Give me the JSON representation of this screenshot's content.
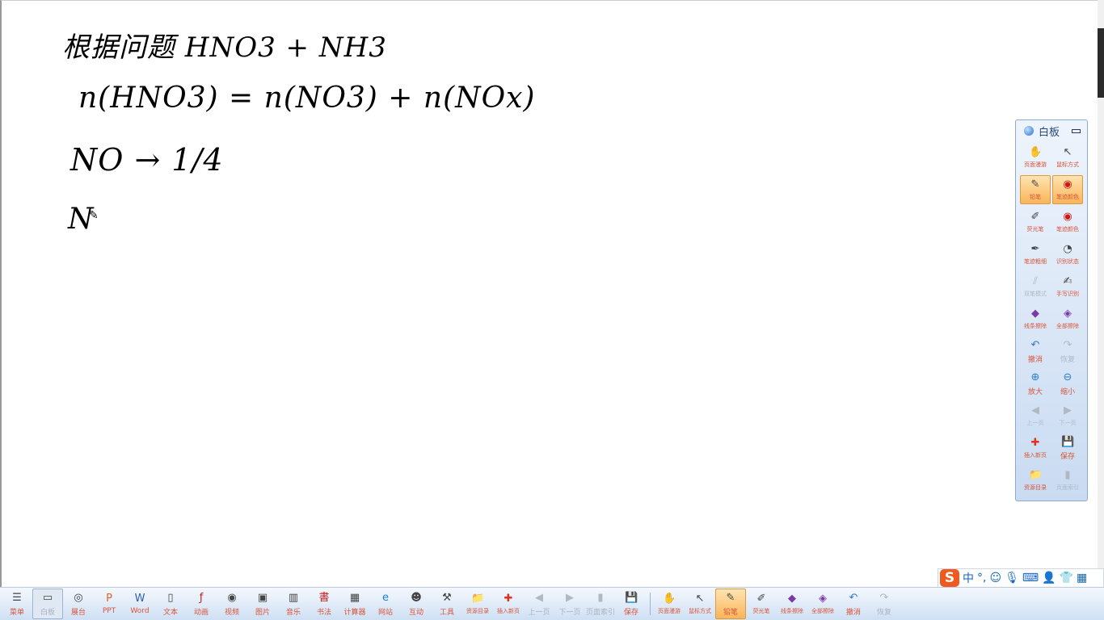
{
  "whiteboard": {
    "lines": [
      "根据问题 HNO3 + NH3",
      "n(HNO3) = n(NO3) + n(NOx)",
      "NO → 1/4",
      "N"
    ]
  },
  "panel": {
    "title": "白板",
    "tools": [
      {
        "label": "页面漫游",
        "icon": "hand-icon",
        "state": "normal"
      },
      {
        "label": "鼠标方式",
        "icon": "cursor-icon",
        "state": "normal"
      },
      {
        "label": "铅笔",
        "icon": "pencil-icon",
        "state": "active"
      },
      {
        "label": "笔迹颜色",
        "icon": "color-icon",
        "state": "active"
      },
      {
        "label": "荧光笔",
        "icon": "highlighter-icon",
        "state": "normal"
      },
      {
        "label": "笔迹颜色",
        "icon": "color-icon",
        "state": "normal"
      },
      {
        "label": "笔迹粗细",
        "icon": "pen-width-icon",
        "state": "normal"
      },
      {
        "label": "识别状态",
        "icon": "recognize-icon",
        "state": "normal"
      },
      {
        "label": "双笔模式",
        "icon": "dual-pen-icon",
        "state": "disabled"
      },
      {
        "label": "手写识别",
        "icon": "handwriting-icon",
        "state": "normal"
      },
      {
        "label": "线条擦除",
        "icon": "eraser-icon",
        "state": "normal"
      },
      {
        "label": "全部擦除",
        "icon": "clear-all-icon",
        "state": "normal"
      },
      {
        "label": "撤消",
        "icon": "undo-icon",
        "state": "big"
      },
      {
        "label": "恢复",
        "icon": "redo-icon",
        "state": "disabled-big"
      },
      {
        "label": "放大",
        "icon": "zoom-in-icon",
        "state": "big"
      },
      {
        "label": "缩小",
        "icon": "zoom-out-icon",
        "state": "big"
      },
      {
        "label": "上一页",
        "icon": "prev-page-icon",
        "state": "disabled"
      },
      {
        "label": "下一页",
        "icon": "next-page-icon",
        "state": "disabled"
      },
      {
        "label": "插入新页",
        "icon": "insert-page-icon",
        "state": "normal"
      },
      {
        "label": "保存",
        "icon": "save-icon",
        "state": "big"
      },
      {
        "label": "资源目录",
        "icon": "folder-icon",
        "state": "normal"
      },
      {
        "label": "页面索引",
        "icon": "page-index-icon",
        "state": "disabled"
      }
    ]
  },
  "taskbar": {
    "items": [
      {
        "label": "菜单",
        "icon": "menu-icon",
        "state": "normal"
      },
      {
        "label": "白板",
        "icon": "whiteboard-icon",
        "state": "selected"
      },
      {
        "label": "展台",
        "icon": "camera-icon",
        "state": "normal"
      },
      {
        "label": "PPT",
        "icon": "ppt-icon",
        "state": "normal"
      },
      {
        "label": "Word",
        "icon": "word-icon",
        "state": "normal"
      },
      {
        "label": "文本",
        "icon": "text-icon",
        "state": "normal"
      },
      {
        "label": "动画",
        "icon": "flash-icon",
        "state": "normal"
      },
      {
        "label": "视频",
        "icon": "video-icon",
        "state": "normal"
      },
      {
        "label": "图片",
        "icon": "image-icon",
        "state": "normal"
      },
      {
        "label": "音乐",
        "icon": "piano-icon",
        "state": "normal"
      },
      {
        "label": "书法",
        "icon": "calligraphy-icon",
        "state": "normal"
      },
      {
        "label": "计算器",
        "icon": "calculator-icon",
        "state": "normal"
      },
      {
        "label": "网站",
        "icon": "ie-icon",
        "state": "normal"
      },
      {
        "label": "互动",
        "icon": "interact-icon",
        "state": "normal"
      },
      {
        "label": "工具",
        "icon": "tools-icon",
        "state": "normal"
      },
      {
        "label": "资源目录",
        "icon": "folder-icon",
        "state": "small"
      },
      {
        "label": "插入新页",
        "icon": "insert-page-icon",
        "state": "small"
      },
      {
        "label": "上一页",
        "icon": "prev-page-icon",
        "state": "disabled"
      },
      {
        "label": "下一页",
        "icon": "next-page-icon",
        "state": "disabled"
      },
      {
        "label": "页面索引",
        "icon": "page-index-icon",
        "state": "disabled"
      },
      {
        "label": "保存",
        "icon": "save-icon",
        "state": "normal"
      },
      {
        "label": "页面漫游",
        "icon": "hand-icon",
        "state": "small"
      },
      {
        "label": "鼠标方式",
        "icon": "cursor-icon",
        "state": "small"
      },
      {
        "label": "铅笔",
        "icon": "pencil-icon",
        "state": "active"
      },
      {
        "label": "荧光笔",
        "icon": "highlighter-icon",
        "state": "small"
      },
      {
        "label": "线条擦除",
        "icon": "eraser-icon",
        "state": "small"
      },
      {
        "label": "全部擦除",
        "icon": "clear-all-icon",
        "state": "small"
      },
      {
        "label": "撤消",
        "icon": "undo-icon",
        "state": "normal"
      },
      {
        "label": "恢复",
        "icon": "redo-icon",
        "state": "disabled"
      }
    ]
  },
  "ime": {
    "logo": "S",
    "mode": "中",
    "punct": "°,"
  },
  "colors": {
    "label": "#d9553a",
    "active": "#f9b55a",
    "panel": "#c9dbf2"
  }
}
